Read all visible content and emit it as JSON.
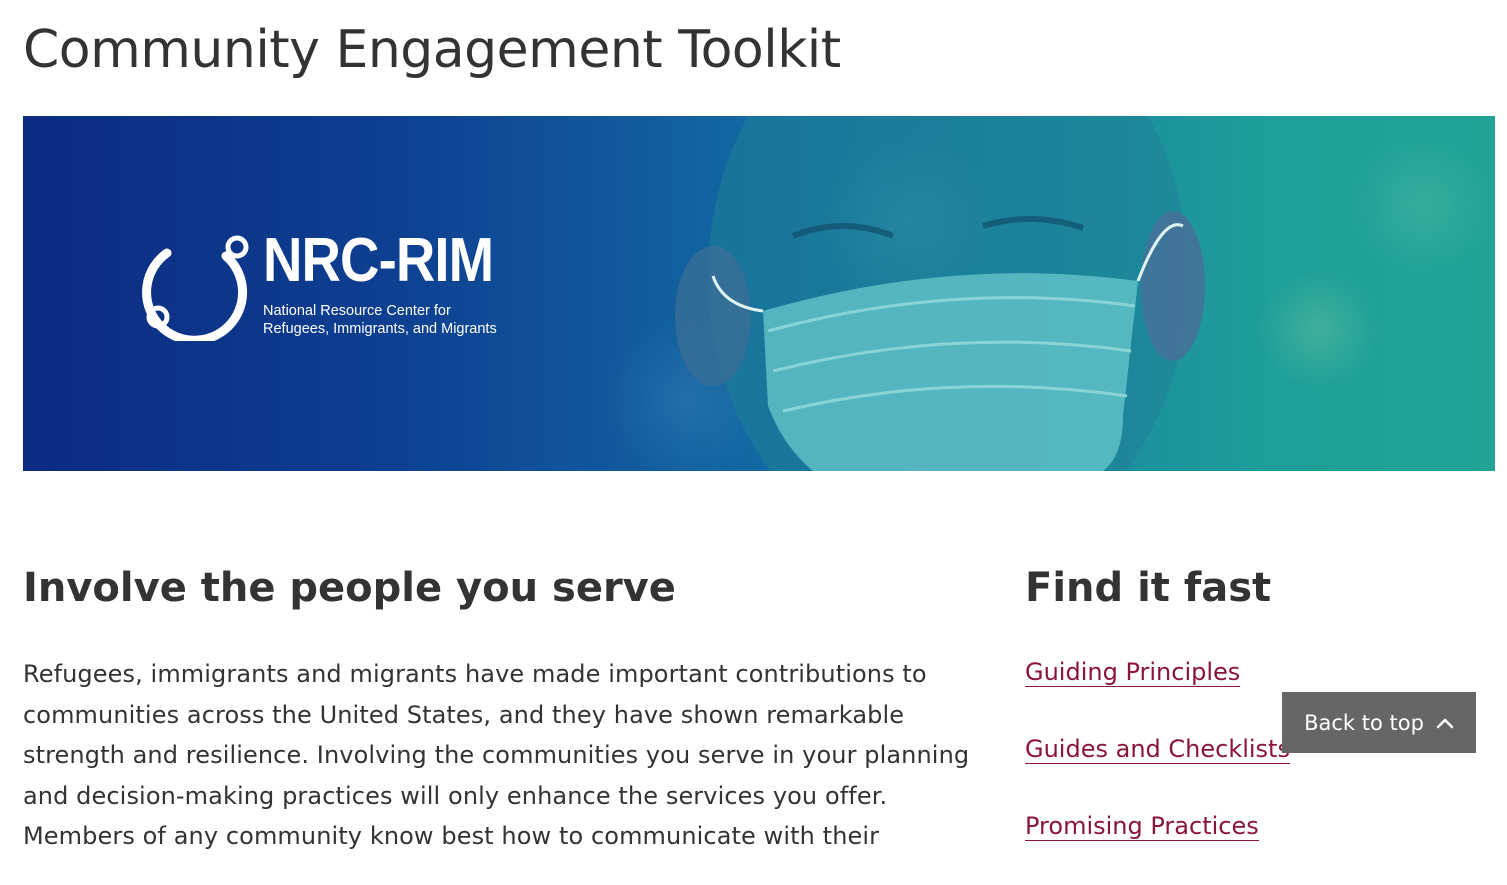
{
  "page": {
    "title": "Community Engagement Toolkit"
  },
  "hero": {
    "logo_name": "NRC-RIM",
    "logo_subtitle_line1": "National Resource Center for",
    "logo_subtitle_line2": "Refugees, Immigrants, and Migrants",
    "icon": "nrc-rim-ring-logo"
  },
  "main": {
    "heading": "Involve the people you serve",
    "intro": "Refugees, immigrants and migrants have made important contributions to communities across the United States, and they have shown remarkable strength and resilience. Involving the communities you serve in your planning and decision-making practices will only enhance the services you offer. Members of any community know best how to communicate with their"
  },
  "sidebar": {
    "heading": "Find it fast",
    "links": [
      {
        "label": "Guiding Principles"
      },
      {
        "label": "Guides and Checklists"
      },
      {
        "label": "Promising Practices"
      }
    ]
  },
  "back_to_top": {
    "label": "Back to top",
    "icon": "chevron-up-icon"
  },
  "colors": {
    "link": "#8a1538",
    "text": "#333333",
    "back_to_top_bg": "#666666",
    "hero_left": "#0b2b80",
    "hero_right": "#22a396"
  }
}
